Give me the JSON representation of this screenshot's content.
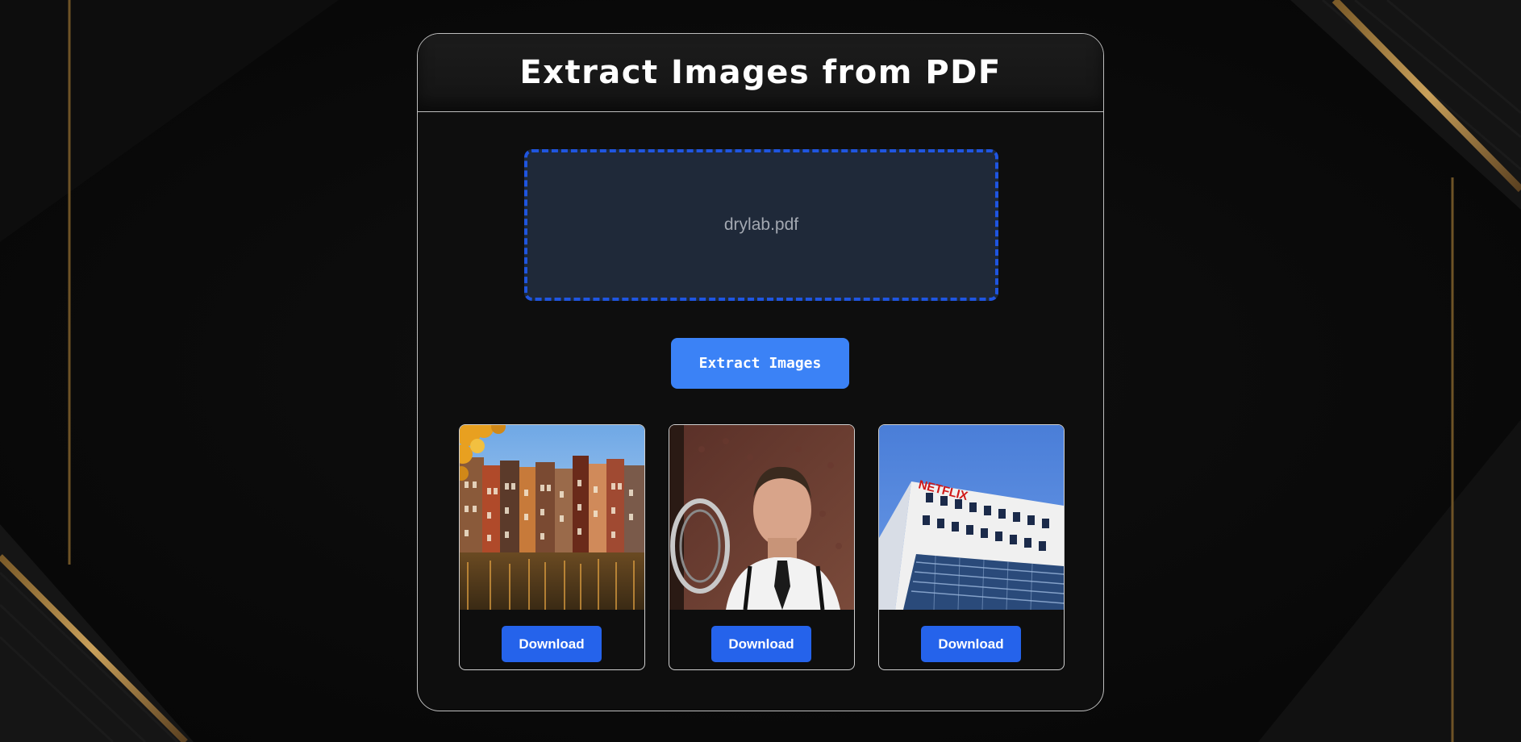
{
  "page": {
    "title": "Extract Images from PDF"
  },
  "dropzone": {
    "file_name": "drylab.pdf"
  },
  "actions": {
    "extract_label": "Extract Images"
  },
  "results": [
    {
      "image": "amsterdam-canal-houses-photo",
      "download_label": "Download"
    },
    {
      "image": "man-with-microphone-photo",
      "download_label": "Download"
    },
    {
      "image": "office-building-photo",
      "download_label": "Download",
      "image_text": "NETFLIX"
    }
  ],
  "colors": {
    "background": "#0b0b0b",
    "card": "#0e0e0e",
    "dropzone_fill": "#1f2939",
    "dropzone_border": "#1f55e0",
    "primary_button": "#3b82f6",
    "download_button": "#2563eb",
    "accent_gold": "#b8893a"
  }
}
